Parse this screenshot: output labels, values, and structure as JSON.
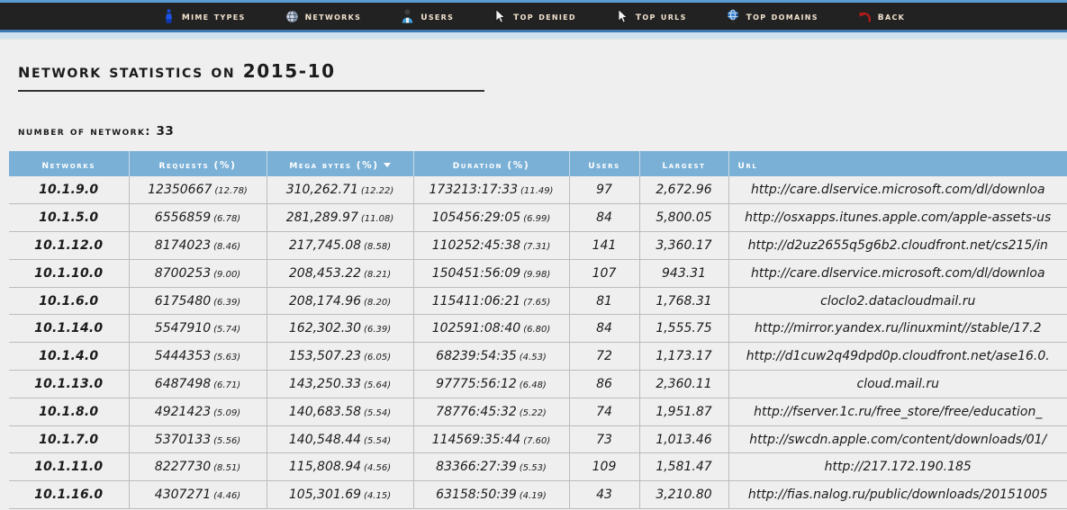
{
  "nav": {
    "items": [
      {
        "label": "Mime Types",
        "icon": "mime-types-icon"
      },
      {
        "label": "Networks",
        "icon": "networks-icon"
      },
      {
        "label": "Users",
        "icon": "users-icon"
      },
      {
        "label": "Top Denied",
        "icon": "cursor-arrow-icon"
      },
      {
        "label": "Top Urls",
        "icon": "cursor-arrow-icon"
      },
      {
        "label": "Top Domains",
        "icon": "globe-icon"
      },
      {
        "label": "Back",
        "icon": "undo-arrow-icon"
      }
    ]
  },
  "page": {
    "title": "Network Statistics on 2015-10",
    "count_label": "Number of network:",
    "count_value": "33"
  },
  "table": {
    "columns": [
      {
        "key": "network",
        "label": "Networks",
        "sorted": false
      },
      {
        "key": "requests",
        "label": "Requests (%)",
        "sorted": false
      },
      {
        "key": "mbytes",
        "label": "Mega bytes (%)",
        "sorted": true
      },
      {
        "key": "duration",
        "label": "Duration (%)",
        "sorted": false
      },
      {
        "key": "users",
        "label": "Users",
        "sorted": false
      },
      {
        "key": "largest",
        "label": "Largest",
        "sorted": false
      },
      {
        "key": "url",
        "label": "Url",
        "sorted": false
      }
    ],
    "rows": [
      {
        "network": "10.1.9.0",
        "requests": "12350667",
        "requests_pct": "(12.78)",
        "mbytes": "310,262.71",
        "mbytes_pct": "(12.22)",
        "duration": "173213:17:33",
        "duration_pct": "(11.49)",
        "users": "97",
        "largest": "2,672.96",
        "url": "http://care.dlservice.microsoft.com/dl/downloa"
      },
      {
        "network": "10.1.5.0",
        "requests": "6556859",
        "requests_pct": "(6.78)",
        "mbytes": "281,289.97",
        "mbytes_pct": "(11.08)",
        "duration": "105456:29:05",
        "duration_pct": "(6.99)",
        "users": "84",
        "largest": "5,800.05",
        "url": "http://osxapps.itunes.apple.com/apple-assets-us"
      },
      {
        "network": "10.1.12.0",
        "requests": "8174023",
        "requests_pct": "(8.46)",
        "mbytes": "217,745.08",
        "mbytes_pct": "(8.58)",
        "duration": "110252:45:38",
        "duration_pct": "(7.31)",
        "users": "141",
        "largest": "3,360.17",
        "url": "http://d2uz2655q5g6b2.cloudfront.net/cs215/in"
      },
      {
        "network": "10.1.10.0",
        "requests": "8700253",
        "requests_pct": "(9.00)",
        "mbytes": "208,453.22",
        "mbytes_pct": "(8.21)",
        "duration": "150451:56:09",
        "duration_pct": "(9.98)",
        "users": "107",
        "largest": "943.31",
        "url": "http://care.dlservice.microsoft.com/dl/downloa"
      },
      {
        "network": "10.1.6.0",
        "requests": "6175480",
        "requests_pct": "(6.39)",
        "mbytes": "208,174.96",
        "mbytes_pct": "(8.20)",
        "duration": "115411:06:21",
        "duration_pct": "(7.65)",
        "users": "81",
        "largest": "1,768.31",
        "url": "cloclo2.datacloudmail.ru"
      },
      {
        "network": "10.1.14.0",
        "requests": "5547910",
        "requests_pct": "(5.74)",
        "mbytes": "162,302.30",
        "mbytes_pct": "(6.39)",
        "duration": "102591:08:40",
        "duration_pct": "(6.80)",
        "users": "84",
        "largest": "1,555.75",
        "url": "http://mirror.yandex.ru/linuxmint//stable/17.2"
      },
      {
        "network": "10.1.4.0",
        "requests": "5444353",
        "requests_pct": "(5.63)",
        "mbytes": "153,507.23",
        "mbytes_pct": "(6.05)",
        "duration": "68239:54:35",
        "duration_pct": "(4.53)",
        "users": "72",
        "largest": "1,173.17",
        "url": "http://d1cuw2q49dpd0p.cloudfront.net/ase16.0."
      },
      {
        "network": "10.1.13.0",
        "requests": "6487498",
        "requests_pct": "(6.71)",
        "mbytes": "143,250.33",
        "mbytes_pct": "(5.64)",
        "duration": "97775:56:12",
        "duration_pct": "(6.48)",
        "users": "86",
        "largest": "2,360.11",
        "url": "cloud.mail.ru"
      },
      {
        "network": "10.1.8.0",
        "requests": "4921423",
        "requests_pct": "(5.09)",
        "mbytes": "140,683.58",
        "mbytes_pct": "(5.54)",
        "duration": "78776:45:32",
        "duration_pct": "(5.22)",
        "users": "74",
        "largest": "1,951.87",
        "url": "http://fserver.1c.ru/free_store/free/education_"
      },
      {
        "network": "10.1.7.0",
        "requests": "5370133",
        "requests_pct": "(5.56)",
        "mbytes": "140,548.44",
        "mbytes_pct": "(5.54)",
        "duration": "114569:35:44",
        "duration_pct": "(7.60)",
        "users": "73",
        "largest": "1,013.46",
        "url": "http://swcdn.apple.com/content/downloads/01/"
      },
      {
        "network": "10.1.11.0",
        "requests": "8227730",
        "requests_pct": "(8.51)",
        "mbytes": "115,808.94",
        "mbytes_pct": "(4.56)",
        "duration": "83366:27:39",
        "duration_pct": "(5.53)",
        "users": "109",
        "largest": "1,581.47",
        "url": "http://217.172.190.185"
      },
      {
        "network": "10.1.16.0",
        "requests": "4307271",
        "requests_pct": "(4.46)",
        "mbytes": "105,301.69",
        "mbytes_pct": "(4.15)",
        "duration": "63158:50:39",
        "duration_pct": "(4.19)",
        "users": "43",
        "largest": "3,210.80",
        "url": "http://fias.nalog.ru/public/downloads/20151005"
      }
    ]
  },
  "colors": {
    "nav_background": "#222222",
    "nav_top_border": "#5a9bd4",
    "nav_label": "#f2e3cf",
    "table_header": "#7ab0d6",
    "page_background": "#efefef"
  }
}
